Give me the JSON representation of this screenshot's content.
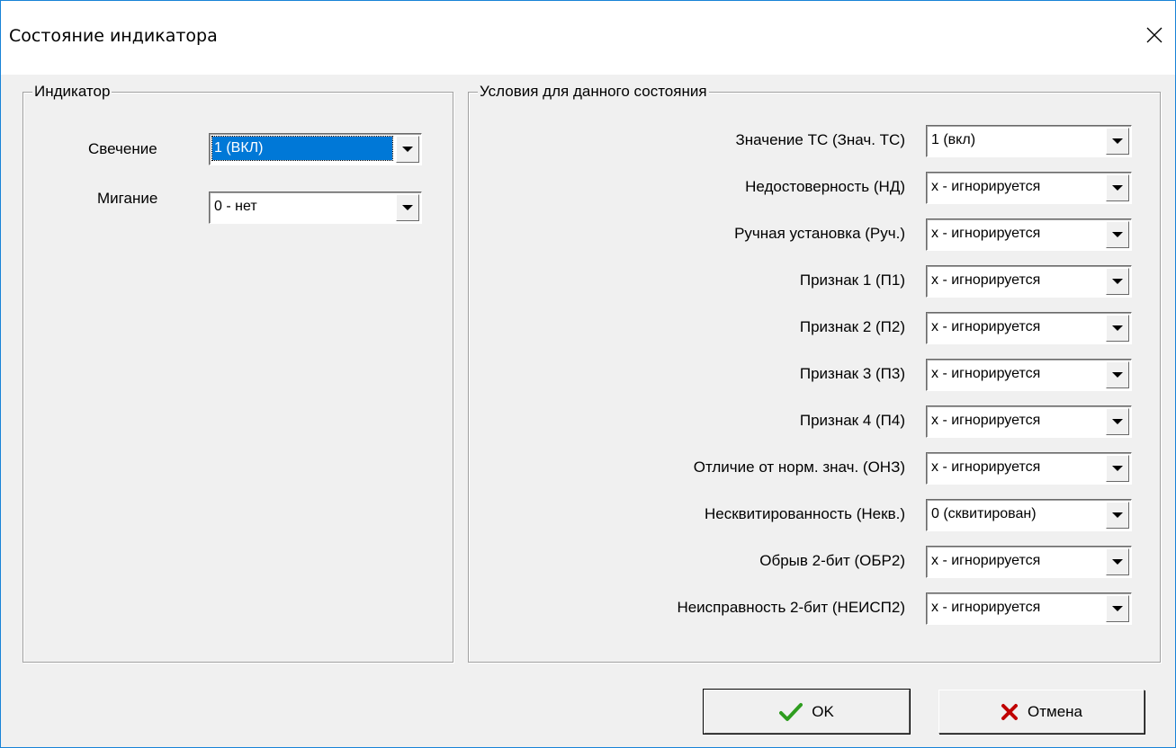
{
  "window": {
    "title": "Состояние индикатора",
    "close_icon": "close-icon"
  },
  "indicator_group": {
    "title": "Индикатор",
    "fields": [
      {
        "label": "Свечение",
        "value": "1 (ВКЛ)",
        "selected": true
      },
      {
        "label": "Мигание",
        "value": "0 - нет",
        "selected": false
      }
    ]
  },
  "conditions_group": {
    "title": "Условия для данного состояния",
    "fields": [
      {
        "label": "Значение ТС (Знач. ТС)",
        "value": "1 (вкл)"
      },
      {
        "label": "Недостоверность (НД)",
        "value": "x - игнорируется"
      },
      {
        "label": "Ручная установка (Руч.)",
        "value": "x - игнорируется"
      },
      {
        "label": "Признак 1 (П1)",
        "value": "x - игнорируется"
      },
      {
        "label": "Признак 2 (П2)",
        "value": "x - игнорируется"
      },
      {
        "label": "Признак 3 (П3)",
        "value": "x - игнорируется"
      },
      {
        "label": "Признак 4 (П4)",
        "value": "x - игнорируется"
      },
      {
        "label": "Отличие от норм. знач. (ОНЗ)",
        "value": "x - игнорируется"
      },
      {
        "label": "Несквитированность (Некв.)",
        "value": "0 (сквитирован)"
      },
      {
        "label": "Обрыв 2-бит (ОБР2)",
        "value": "x - игнорируется"
      },
      {
        "label": "Неисправность 2-бит (НЕИСП2)",
        "value": "x - игнорируется"
      }
    ]
  },
  "buttons": {
    "ok_label": "OK",
    "ok_icon": "checkmark-icon",
    "cancel_label": "Отмена",
    "cancel_icon": "cross-icon"
  },
  "colors": {
    "selection": "#0078d7",
    "window_border": "#1883d7",
    "ok_icon": "#2e9d1f",
    "cancel_icon": "#c00000"
  }
}
